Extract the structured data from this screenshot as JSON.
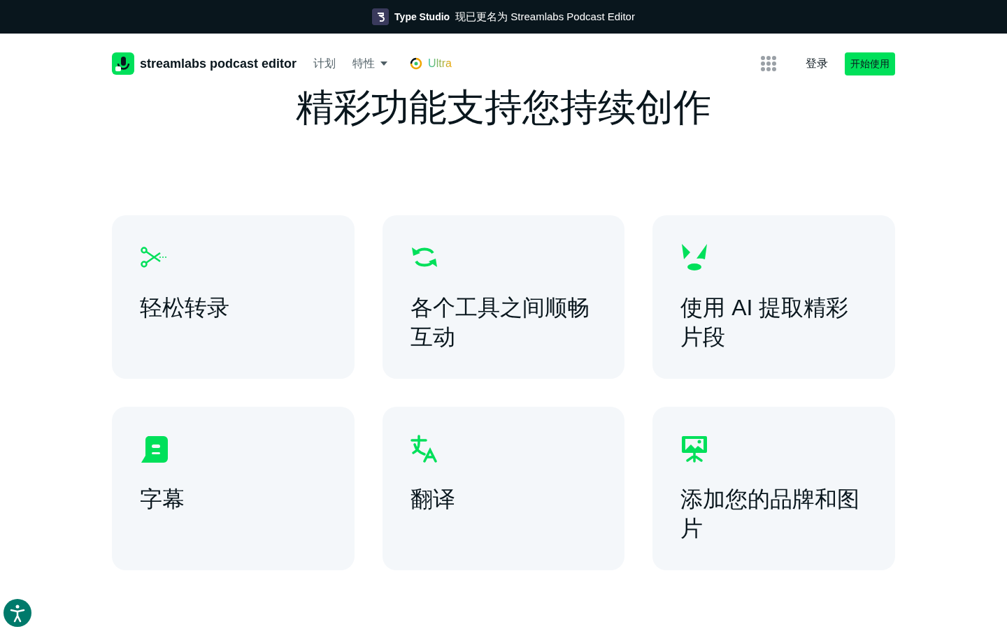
{
  "banner": {
    "brand": "Type Studio",
    "message": "现已更名为 Streamlabs Podcast Editor"
  },
  "navbar": {
    "logo_text": "streamlabs podcast editor",
    "links": [
      {
        "label": "计划",
        "kind": "plain"
      },
      {
        "label": "特性",
        "kind": "dropdown"
      },
      {
        "label": "Ultra",
        "kind": "ultra"
      }
    ],
    "login": "登录",
    "cta": "开始使用"
  },
  "heading": "精彩功能支持您持续创作",
  "features": [
    {
      "kind": "scissors",
      "title": "轻松转录"
    },
    {
      "kind": "sync",
      "title": "各个工具之间顺畅互动"
    },
    {
      "kind": "highlight",
      "title": "使用 AI 提取精彩片段"
    },
    {
      "kind": "subtitles",
      "title": "字幕"
    },
    {
      "kind": "translate",
      "title": "翻译"
    },
    {
      "kind": "brand",
      "title": "添加您的品牌和图片"
    }
  ]
}
